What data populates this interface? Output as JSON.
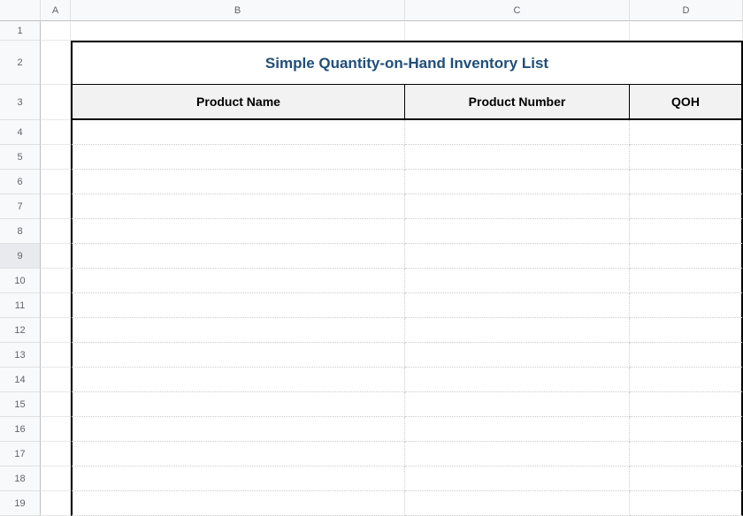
{
  "columns": {
    "a": "A",
    "b": "B",
    "c": "C",
    "d": "D"
  },
  "rows": {
    "r1": "1",
    "r2": "2",
    "r3": "3",
    "r4": "4",
    "r5": "5",
    "r6": "6",
    "r7": "7",
    "r8": "8",
    "r9": "9",
    "r10": "10",
    "r11": "11",
    "r12": "12",
    "r13": "13",
    "r14": "14",
    "r15": "15",
    "r16": "16",
    "r17": "17",
    "r18": "18",
    "r19": "19"
  },
  "sheet": {
    "title": "Simple Quantity-on-Hand Inventory List",
    "headers": {
      "product_name": "Product Name",
      "product_number": "Product Number",
      "qoh": "QOH"
    }
  },
  "selected_row": "9"
}
